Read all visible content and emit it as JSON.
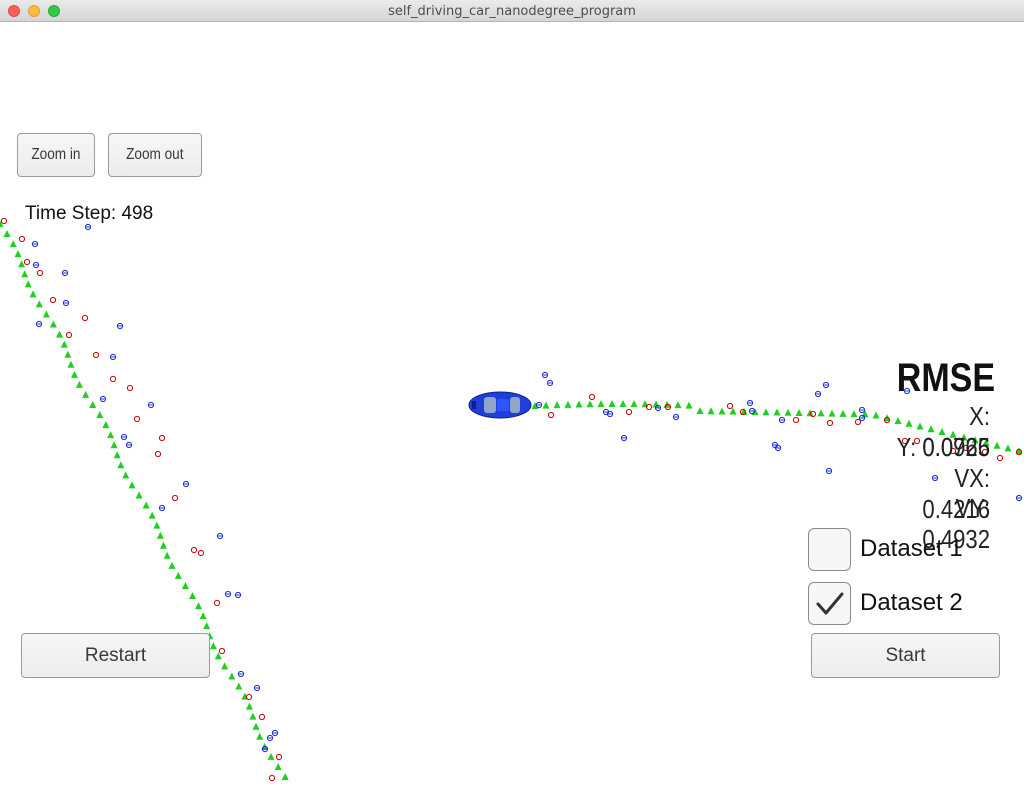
{
  "window": {
    "title": "self_driving_car_nanodegree_program"
  },
  "controls": {
    "zoom_in": "Zoom in",
    "zoom_out": "Zoom out",
    "restart": "Restart",
    "start": "Start"
  },
  "status": {
    "time_step": "Time Step: 498"
  },
  "rmse": {
    "title": "RMSE",
    "x": "X: 0.0726",
    "y": "Y: 0.0965",
    "vx": "VX: 0.4216",
    "vy": "VY: 0.4932"
  },
  "datasets": [
    {
      "label": "Dataset 1",
      "checked": false
    },
    {
      "label": "Dataset 2",
      "checked": true
    }
  ],
  "colors": {
    "lidar": "#d40000",
    "radar": "#1a2bd6",
    "estimate": "#1fd01f",
    "car": "#1f3fd8"
  },
  "icons": {
    "lidar_marker": "red-circle",
    "radar_marker": "blue-circle-with-arrow",
    "estimate_marker": "green-triangle",
    "car": "car-icon",
    "check": "checkmark-icon"
  }
}
